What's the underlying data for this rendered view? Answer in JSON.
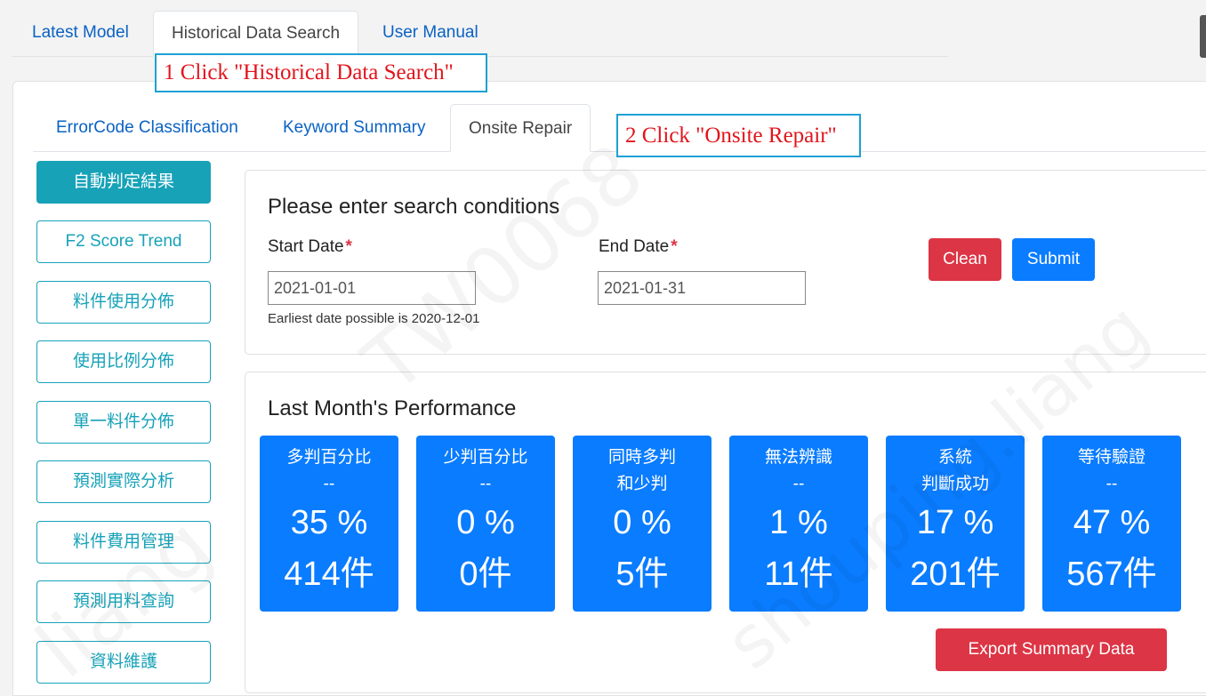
{
  "top_tabs": [
    {
      "label": "Latest Model",
      "active": false
    },
    {
      "label": "Historical Data Search",
      "active": true
    },
    {
      "label": "User Manual",
      "active": false
    }
  ],
  "annotations": {
    "step1": "1 Click \"Historical Data Search\"",
    "step2": "2 Click \"Onsite Repair\""
  },
  "sub_tabs": [
    {
      "label": "ErrorCode Classification",
      "active": false
    },
    {
      "label": "Keyword Summary",
      "active": false
    },
    {
      "label": "Onsite Repair",
      "active": true
    }
  ],
  "sidebar": {
    "items": [
      {
        "label": "自動判定結果",
        "active": true
      },
      {
        "label": "F2 Score Trend",
        "active": false
      },
      {
        "label": "料件使用分佈",
        "active": false
      },
      {
        "label": "使用比例分佈",
        "active": false
      },
      {
        "label": "單一料件分佈",
        "active": false
      },
      {
        "label": "預測實際分析",
        "active": false
      },
      {
        "label": "料件費用管理",
        "active": false
      },
      {
        "label": "預測用料查詢",
        "active": false
      },
      {
        "label": "資料維護",
        "active": false
      }
    ]
  },
  "search": {
    "title": "Please enter search conditions",
    "start_label": "Start Date",
    "end_label": "End Date",
    "required_mark": "*",
    "start_value": "2021-01-01",
    "end_value": "2021-01-31",
    "hint": "Earliest date possible is 2020-12-01",
    "clean_label": "Clean",
    "submit_label": "Submit"
  },
  "performance": {
    "title": "Last Month's Performance",
    "export_label": "Export Summary Data",
    "stats": [
      {
        "line1": "多判百分比",
        "line2": "--",
        "percent": "35 %",
        "count": "414件"
      },
      {
        "line1": "少判百分比",
        "line2": "--",
        "percent": "0 %",
        "count": "0件"
      },
      {
        "line1": "同時多判",
        "line2": "和少判",
        "percent": "0 %",
        "count": "5件"
      },
      {
        "line1": "無法辨識",
        "line2": "--",
        "percent": "1 %",
        "count": "11件"
      },
      {
        "line1": "系統",
        "line2": "判斷成功",
        "percent": "17 %",
        "count": "201件"
      },
      {
        "line1": "等待驗證",
        "line2": "--",
        "percent": "47 %",
        "count": "567件"
      }
    ]
  },
  "watermark": {
    "text1": "TW0068",
    "text2": "liang",
    "text3": "shouping.liang"
  },
  "colors": {
    "primary": "#0a7cff",
    "info": "#17a2b8",
    "danger": "#dc3545",
    "link": "#0a62c4",
    "annotation_border": "#1da1d4",
    "annotation_text": "#e2141c"
  }
}
